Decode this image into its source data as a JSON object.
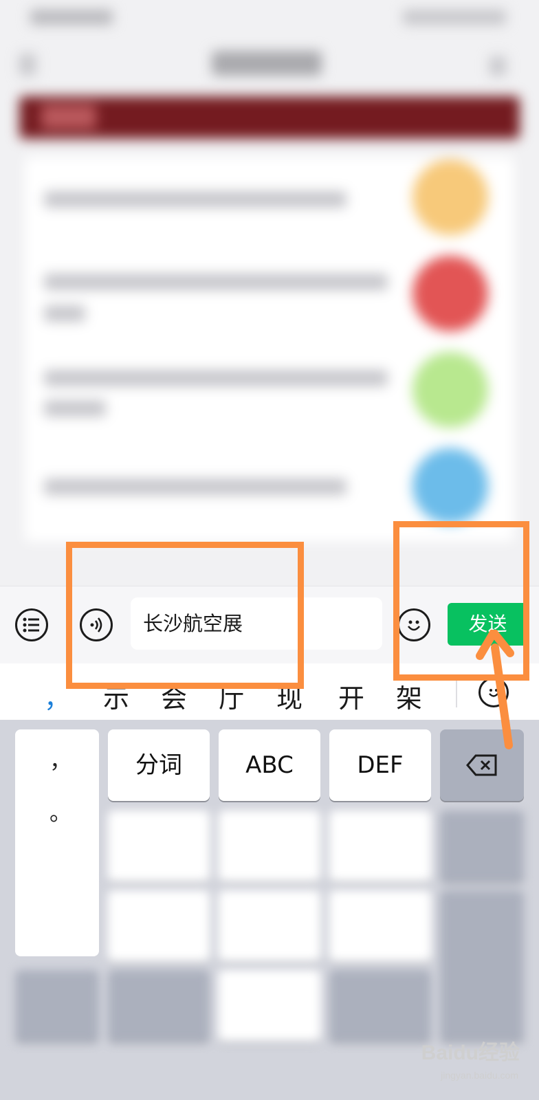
{
  "composer": {
    "input_value": "长沙航空展",
    "send_label": "发送"
  },
  "candidates": {
    "first": "，",
    "items": [
      "示",
      "会",
      "厅",
      "现",
      "开",
      "架"
    ]
  },
  "keyboard": {
    "punct": [
      "，",
      "。"
    ],
    "keys": {
      "segment": "分词",
      "abc": "ABC",
      "def": "DEF"
    }
  },
  "colors": {
    "send_button": "#08c160",
    "annotation": "#fb8e3f",
    "banner": "#741b20"
  },
  "icons": {
    "list": "list-icon",
    "voice": "voice-icon",
    "emoji": "emoji-icon",
    "backspace": "backspace-icon",
    "candidate_emoji": "smiley-icon"
  },
  "watermark": {
    "brand": "Baidu经验",
    "url": "jingyan.baidu.com"
  }
}
